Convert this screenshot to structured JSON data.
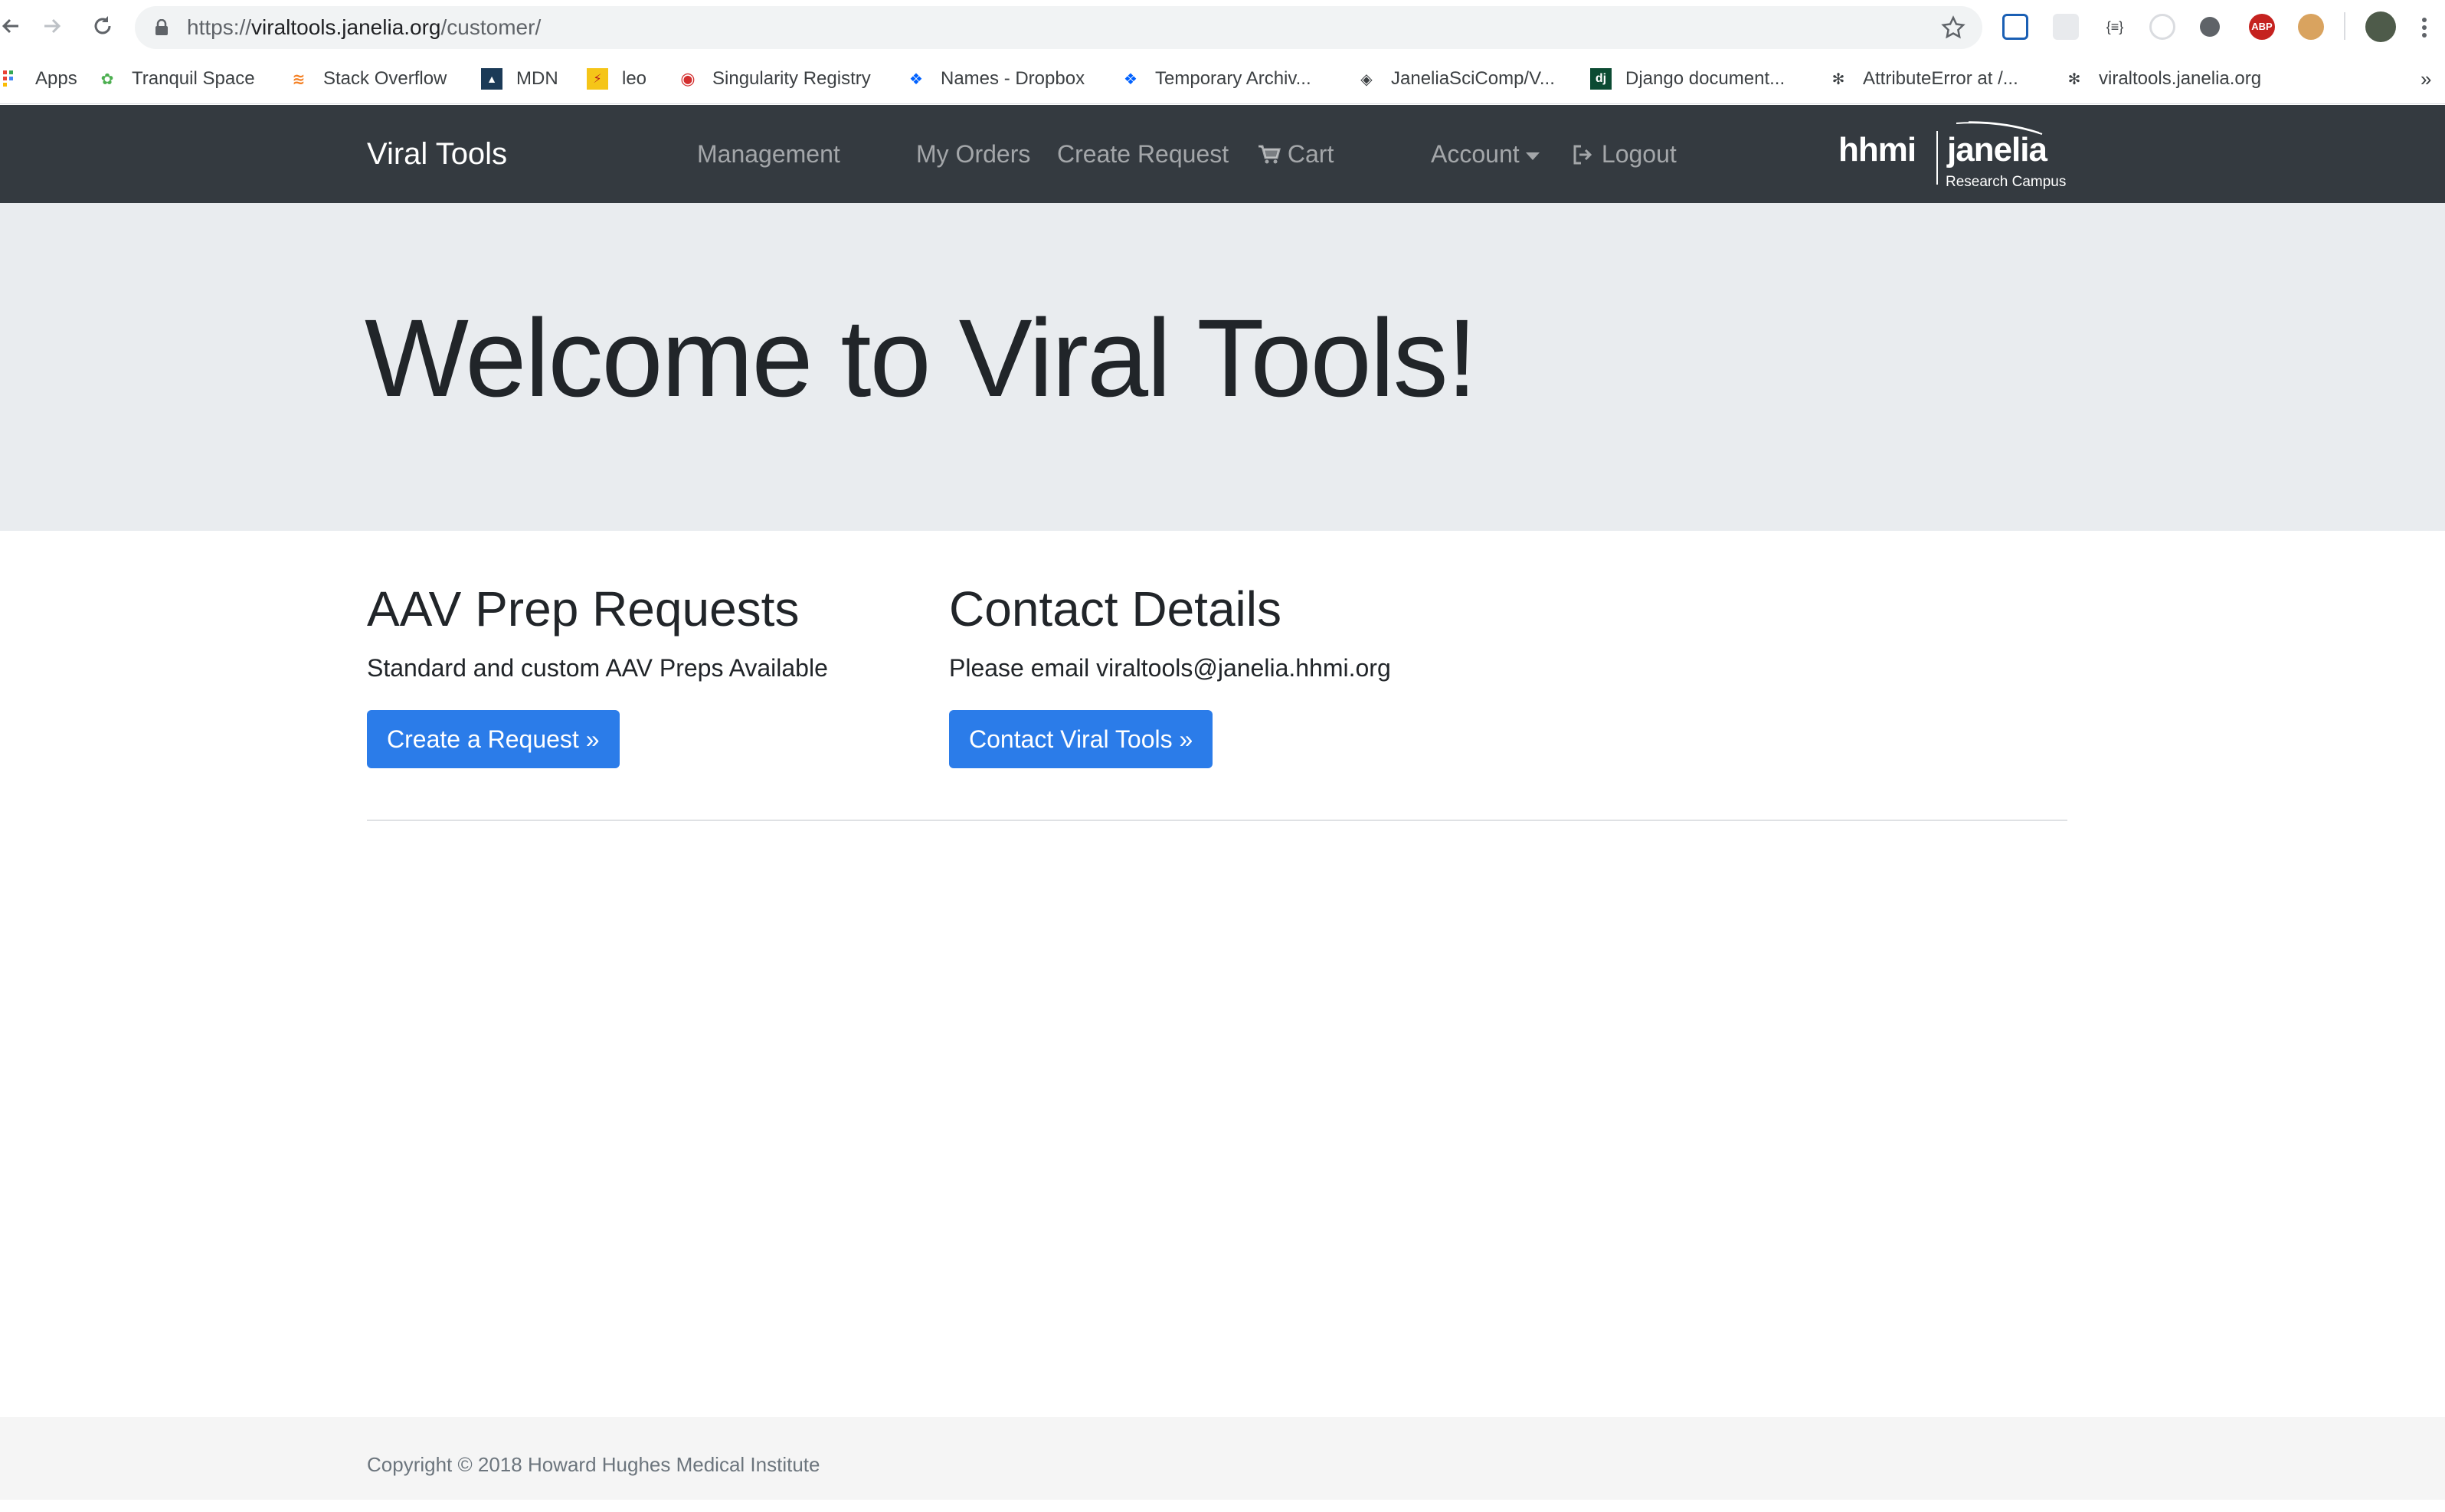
{
  "browser": {
    "url_scheme": "https://",
    "url_host": "viraltools.janelia.org",
    "url_path": "/customer/",
    "bookmarks": [
      {
        "label": "Apps",
        "icon": "apps-grid-icon"
      },
      {
        "label": "Tranquil Space",
        "icon": "tranquil-space-icon"
      },
      {
        "label": "Stack Overflow",
        "icon": "stack-overflow-icon"
      },
      {
        "label": "MDN",
        "icon": "mdn-icon"
      },
      {
        "label": "leo",
        "icon": "leo-icon"
      },
      {
        "label": "Singularity Registry",
        "icon": "singularity-icon"
      },
      {
        "label": "Names - Dropbox",
        "icon": "dropbox-icon"
      },
      {
        "label": "Temporary Archiv...",
        "icon": "dropbox-icon"
      },
      {
        "label": "JaneliaSciComp/V...",
        "icon": "github-icon"
      },
      {
        "label": "Django document...",
        "icon": "django-icon"
      },
      {
        "label": "AttributeError at /...",
        "icon": "snowflake-icon"
      },
      {
        "label": "viraltools.janelia.org",
        "icon": "snowflake-icon"
      }
    ],
    "overflow_label": "»"
  },
  "navbar": {
    "brand": "Viral Tools",
    "links": {
      "management": "Management",
      "my_orders": "My Orders",
      "create_request": "Create Request",
      "cart": "Cart",
      "account": "Account",
      "logout": "Logout"
    },
    "logo": {
      "hhmi": "hhmi",
      "janelia": "janelia",
      "subtitle": "Research Campus"
    }
  },
  "jumbotron": {
    "heading": "Welcome to Viral Tools!"
  },
  "sections": {
    "aav": {
      "heading": "AAV Prep Requests",
      "text": "Standard and custom AAV Preps Available",
      "button": "Create a Request »"
    },
    "contact": {
      "heading": "Contact Details",
      "text": "Please email viraltools@janelia.hhmi.org",
      "button": "Contact Viral Tools »"
    }
  },
  "footer": {
    "copyright": "Copyright © 2018 Howard Hughes Medical Institute"
  },
  "colors": {
    "navbar_bg": "#343a40",
    "jumbotron_bg": "#e9ecef",
    "primary_button": "#2b7ce9",
    "footer_bg": "#f5f5f5"
  }
}
